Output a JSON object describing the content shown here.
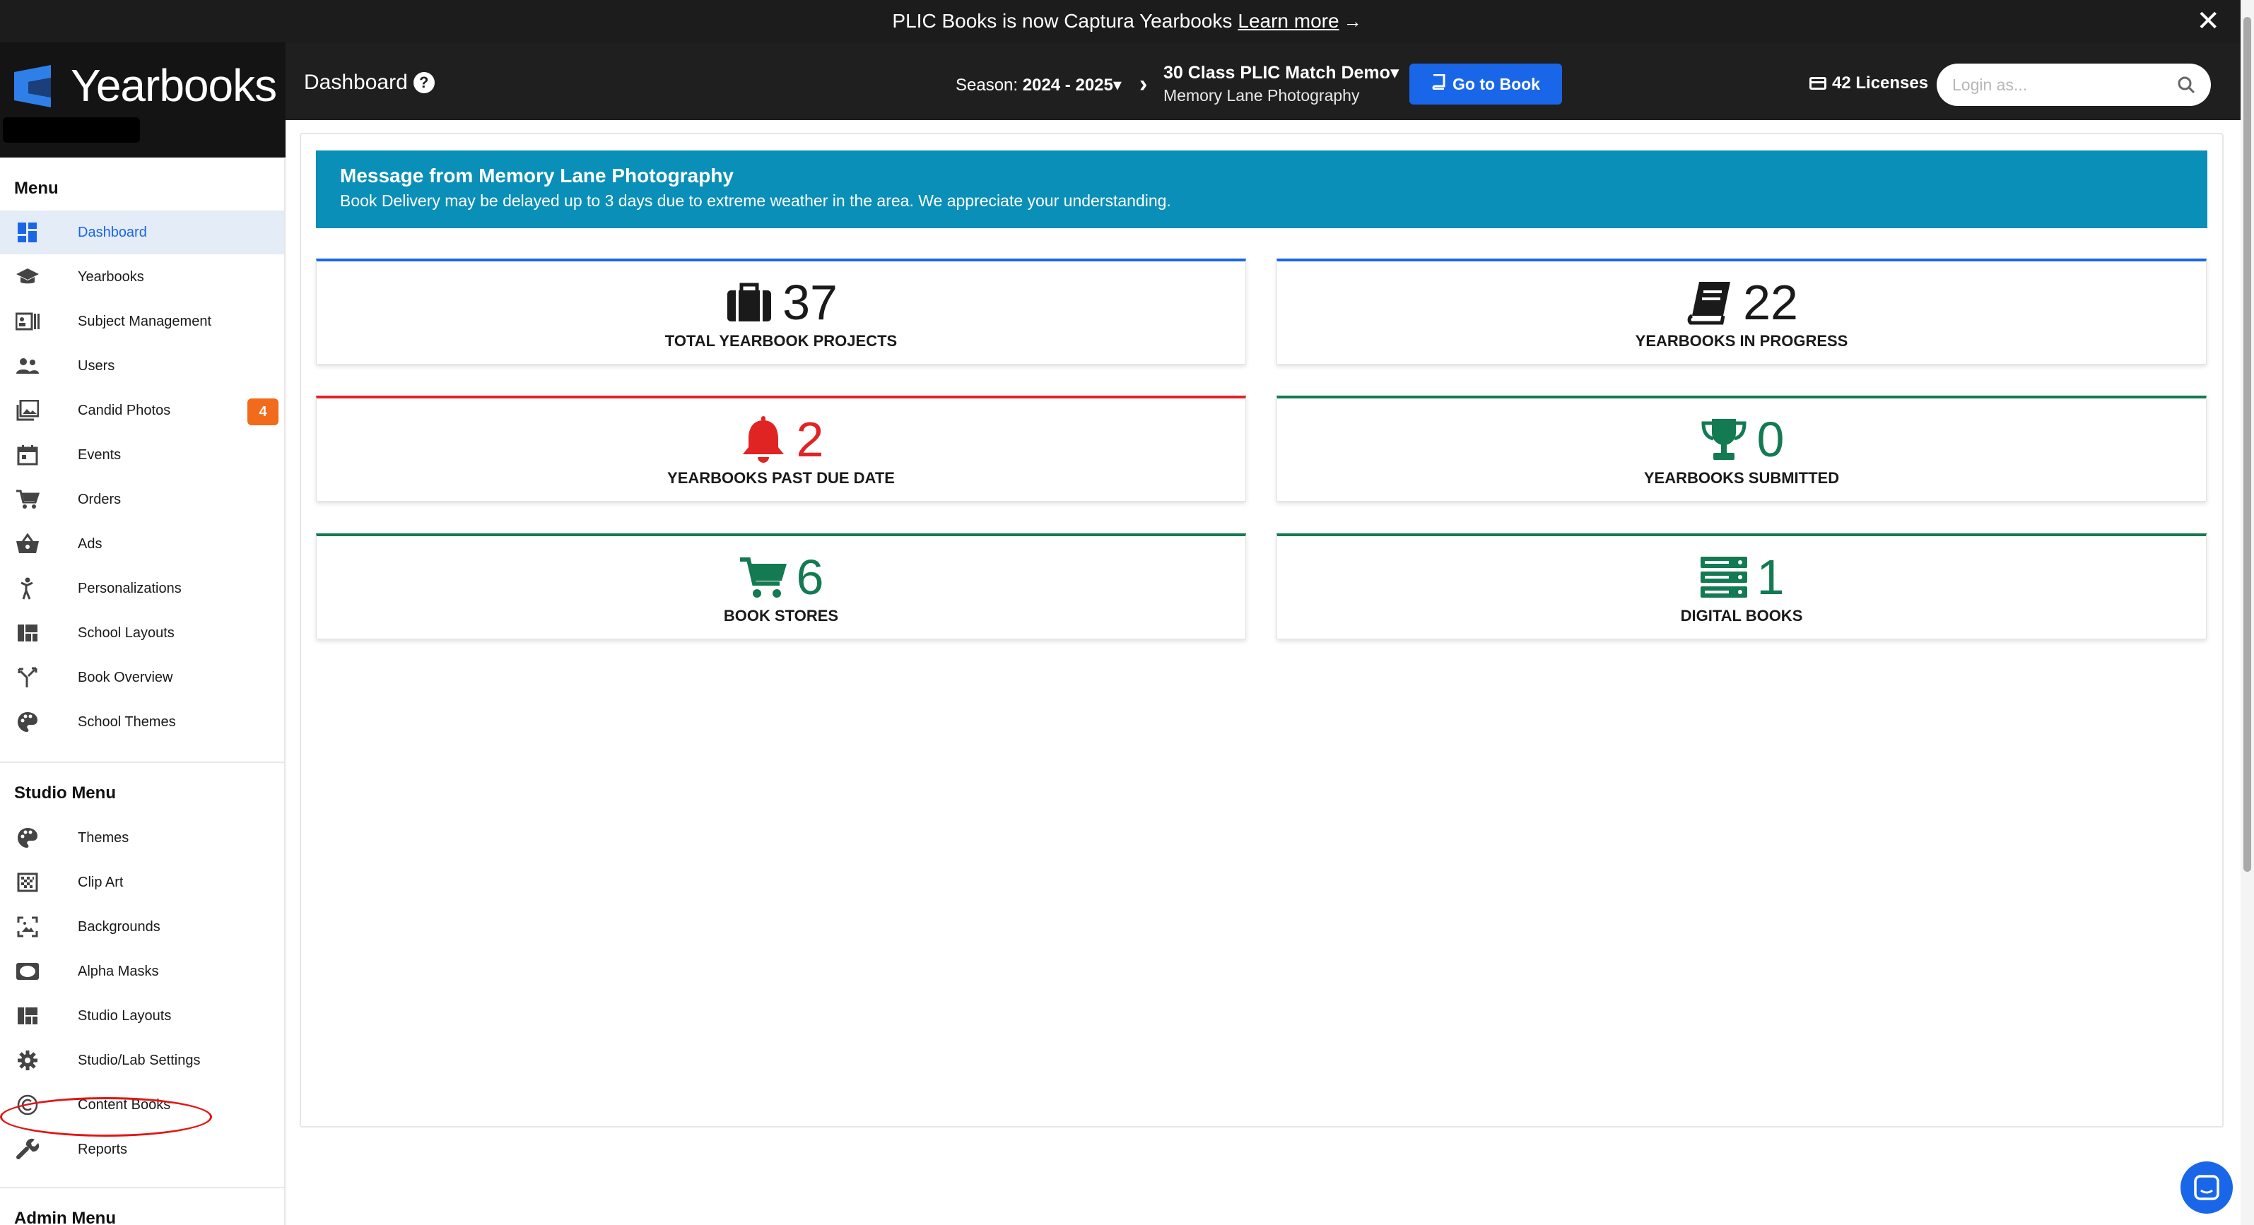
{
  "announcement": {
    "text": "PLIC Books is now Captura Yearbooks",
    "link": "Learn more",
    "arrow": "→",
    "close": "✕"
  },
  "brand": {
    "name": "Yearbooks"
  },
  "header": {
    "page_title": "Dashboard",
    "help": "?",
    "season_label": "Season:",
    "season_value": "2024 - 2025",
    "caret": "▾",
    "chevron": "›",
    "book_name": "30 Class PLIC Match Demo",
    "studio_name": "Memory Lane Photography",
    "goto_button": "Go to Book",
    "licenses": "42 Licenses",
    "login_placeholder": "Login as..."
  },
  "sidebar": {
    "menu_title": "Menu",
    "menu_items": [
      {
        "label": "Dashboard",
        "icon": "dashboard-icon",
        "active": true
      },
      {
        "label": "Yearbooks",
        "icon": "graduation-cap-icon"
      },
      {
        "label": "Subject Management",
        "icon": "id-card-icon"
      },
      {
        "label": "Users",
        "icon": "users-icon"
      },
      {
        "label": "Candid Photos",
        "icon": "photos-icon",
        "badge": "4"
      },
      {
        "label": "Events",
        "icon": "calendar-icon"
      },
      {
        "label": "Orders",
        "icon": "cart-icon"
      },
      {
        "label": "Ads",
        "icon": "basket-icon"
      },
      {
        "label": "Personalizations",
        "icon": "person-icon"
      },
      {
        "label": "School Layouts",
        "icon": "layout-icon"
      },
      {
        "label": "Book Overview",
        "icon": "split-arrow-icon"
      },
      {
        "label": "School Themes",
        "icon": "palette-icon"
      }
    ],
    "studio_title": "Studio Menu",
    "studio_items": [
      {
        "label": "Themes",
        "icon": "palette-icon"
      },
      {
        "label": "Clip Art",
        "icon": "clip-art-icon"
      },
      {
        "label": "Backgrounds",
        "icon": "background-icon"
      },
      {
        "label": "Alpha Masks",
        "icon": "mask-icon"
      },
      {
        "label": "Studio Layouts",
        "icon": "layout-icon"
      },
      {
        "label": "Studio/Lab Settings",
        "icon": "gear-icon"
      },
      {
        "label": "Content Books",
        "icon": "copyright-icon"
      },
      {
        "label": "Reports",
        "icon": "wrench-icon"
      }
    ],
    "admin_title": "Admin Menu"
  },
  "message": {
    "title": "Message from Memory Lane Photography",
    "body": "Book Delivery may be delayed up to 3 days due to extreme weather in the area. We appreciate your understanding."
  },
  "stats": [
    {
      "value": "37",
      "label": "TOTAL YEARBOOK PROJECTS",
      "icon": "briefcase-icon",
      "color": "#1a1a1a",
      "accent": "#1a66e8"
    },
    {
      "value": "22",
      "label": "YEARBOOKS IN PROGRESS",
      "icon": "book-icon",
      "color": "#1a1a1a",
      "accent": "#1a66e8"
    },
    {
      "value": "2",
      "label": "YEARBOOKS PAST DUE DATE",
      "icon": "bell-icon",
      "color": "#e02424",
      "accent": "#e02424"
    },
    {
      "value": "0",
      "label": "YEARBOOKS SUBMITTED",
      "icon": "trophy-icon",
      "color": "#137a52",
      "accent": "#137a52"
    },
    {
      "value": "6",
      "label": "BOOK STORES",
      "icon": "cart-icon",
      "color": "#137a52",
      "accent": "#137a52"
    },
    {
      "value": "1",
      "label": "DIGITAL BOOKS",
      "icon": "server-icon",
      "color": "#137a52",
      "accent": "#137a52"
    }
  ],
  "colors": {
    "primary": "#1a66e8",
    "message_bg": "#0a8fb8",
    "badge": "#f26a1b",
    "danger": "#e02424",
    "success": "#137a52"
  }
}
